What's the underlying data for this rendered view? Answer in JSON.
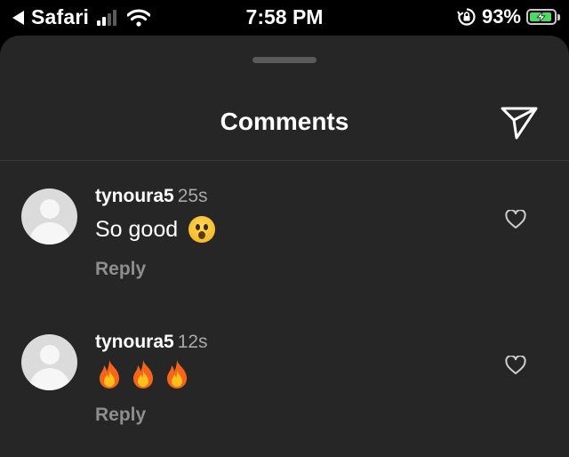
{
  "status_bar": {
    "back_app": "Safari",
    "time": "7:58 PM",
    "battery_percent": "93%",
    "battery_level": 0.93,
    "signal_bars": 2,
    "colors": {
      "battery_fill": "#4cd964"
    }
  },
  "sheet": {
    "title": "Comments",
    "share_icon": "paper-plane-icon",
    "background": "#262626"
  },
  "comments": [
    {
      "username": "tynoura5",
      "time": "25s",
      "text": "So good",
      "emoji": "astonished-face",
      "reply_label": "Reply"
    },
    {
      "username": "tynoura5",
      "time": "12s",
      "text": "",
      "emoji": "fire x3",
      "reply_label": "Reply"
    }
  ]
}
